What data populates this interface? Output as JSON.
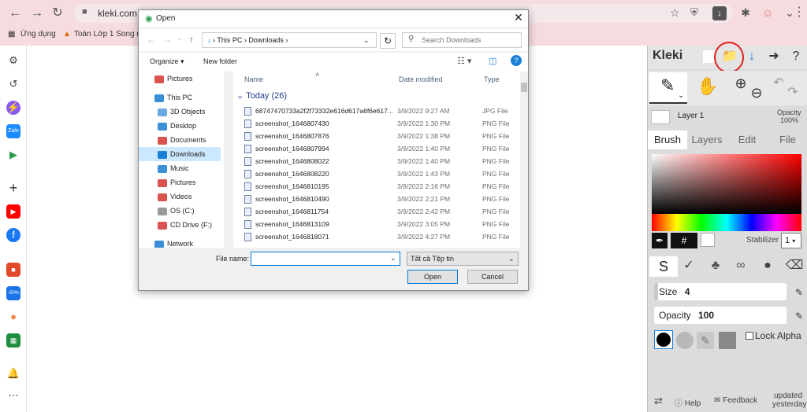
{
  "browser": {
    "url": "kleki.com",
    "bookmarks": [
      {
        "label": "Ứng dụng"
      },
      {
        "label": "Toán Lớp 1 Song ng"
      }
    ]
  },
  "dialog": {
    "title": "Open",
    "breadcrumb": [
      "This PC",
      "Downloads"
    ],
    "search_placeholder": "Search Downloads",
    "organize_label": "Organize ▾",
    "new_folder_label": "New folder",
    "nav_items": [
      {
        "label": "Pictures"
      },
      {
        "label": "This PC"
      },
      {
        "label": "3D Objects"
      },
      {
        "label": "Desktop"
      },
      {
        "label": "Documents"
      },
      {
        "label": "Downloads"
      },
      {
        "label": "Music"
      },
      {
        "label": "Pictures"
      },
      {
        "label": "Videos"
      },
      {
        "label": "OS (C:)"
      },
      {
        "label": "CD Drive (F:)"
      },
      {
        "label": "Network"
      }
    ],
    "columns": {
      "name": "Name",
      "date": "Date modified",
      "type": "Type"
    },
    "group_label": "Today (26)",
    "files": [
      {
        "name": "68747470733a2f2f73332e616d617a6f6e617...",
        "date": "3/9/2022 9:27 AM",
        "type": "JPG File"
      },
      {
        "name": "screenshot_1646807430",
        "date": "3/9/2022 1:30 PM",
        "type": "PNG File"
      },
      {
        "name": "screenshot_1646807876",
        "date": "3/9/2022 1:38 PM",
        "type": "PNG File"
      },
      {
        "name": "screenshot_1646807994",
        "date": "3/9/2022 1:40 PM",
        "type": "PNG File"
      },
      {
        "name": "screenshot_1646808022",
        "date": "3/9/2022 1:40 PM",
        "type": "PNG File"
      },
      {
        "name": "screenshot_1646808220",
        "date": "3/9/2022 1:43 PM",
        "type": "PNG File"
      },
      {
        "name": "screenshot_1646810195",
        "date": "3/9/2022 2:16 PM",
        "type": "PNG File"
      },
      {
        "name": "screenshot_1646810490",
        "date": "3/9/2022 2:21 PM",
        "type": "PNG File"
      },
      {
        "name": "screenshot_1646811754",
        "date": "3/9/2022 2:42 PM",
        "type": "PNG File"
      },
      {
        "name": "screenshot_1646813109",
        "date": "3/9/2022 3:05 PM",
        "type": "PNG File"
      },
      {
        "name": "screenshot_1646818071",
        "date": "3/9/2022 4:27 PM",
        "type": "PNG File"
      }
    ],
    "file_name_label": "File name:",
    "file_name_value": "",
    "file_type": "Tất cả Tệp tin",
    "open_label": "Open",
    "cancel_label": "Cancel"
  },
  "kleki": {
    "logo": "Kleki",
    "layer_name": "Layer 1",
    "opacity_label": "Opacity",
    "opacity_value": "100%",
    "tabs": [
      "Brush",
      "Layers",
      "Edit",
      "File"
    ],
    "hash_label": "#",
    "stabilizer_label": "Stabilizer",
    "stabilizer_value": "1",
    "size_label": "Size",
    "size_value": "4",
    "brush_opacity_label": "Opacity",
    "brush_opacity_value": "100",
    "lock_alpha_label": "Lock Alpha",
    "help_label": "Help",
    "feedback_label": "Feedback",
    "updated_label": "updated",
    "updated_when": "yesterday"
  },
  "colors": {
    "accent": "#0078d7",
    "highlight": "#e02020",
    "chrome_bg": "#f7dcdf"
  }
}
